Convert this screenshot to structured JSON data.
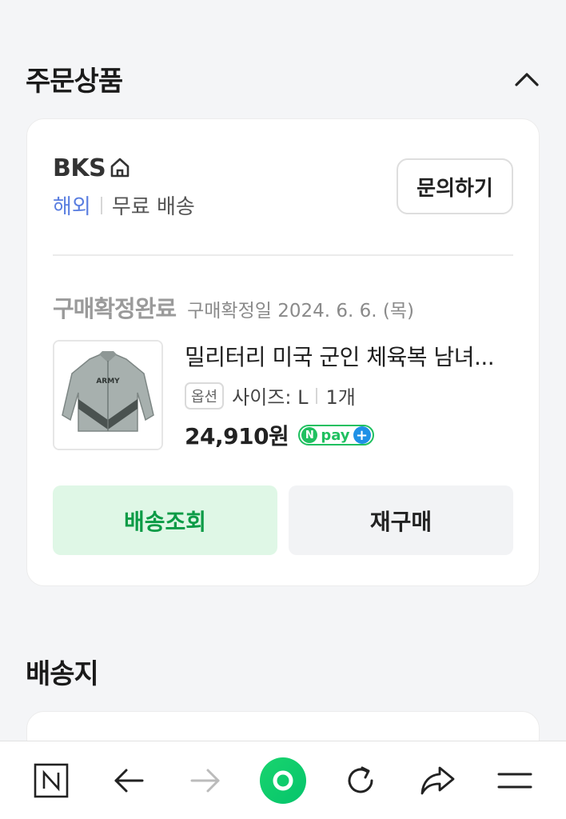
{
  "order_section": {
    "title": "주문상품"
  },
  "seller": {
    "name": "BKS",
    "region": "해외",
    "shipping": "무료 배송",
    "inquiry_label": "문의하기"
  },
  "order": {
    "status": "구매확정완료",
    "confirm_date": "구매확정일 2024. 6. 6. (목)"
  },
  "product": {
    "name": "밀리터리 미국 군인 체육복 남녀...",
    "option_badge": "옵션",
    "size": "사이즈: L",
    "quantity": "1개",
    "price": "24,910원",
    "thumb_text": "ARMY",
    "npay_text": "pay"
  },
  "actions": {
    "track_label": "배송조회",
    "rebuy_label": "재구매"
  },
  "address_section": {
    "title": "배송지"
  },
  "colors": {
    "accent_green": "#0b9b46",
    "track_bg": "#dff7e6",
    "overseas_blue": "#5a7ee0",
    "npay_green": "#20c060"
  },
  "icons": [
    "chevron-up-icon",
    "home-icon",
    "naver-n-icon",
    "back-arrow-icon",
    "forward-arrow-icon",
    "green-dot-icon",
    "refresh-icon",
    "share-icon",
    "menu-icon"
  ]
}
